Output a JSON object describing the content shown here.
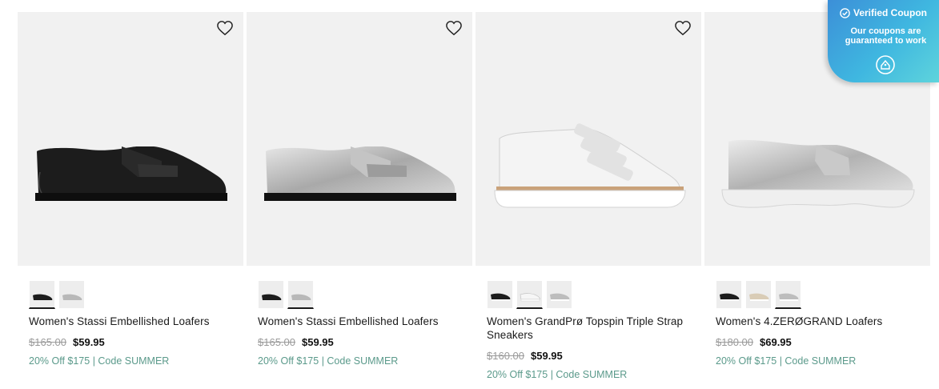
{
  "products": [
    {
      "name": "Women's Stassi Embellished Loafers",
      "was_price": "$165.00",
      "price": "$59.95",
      "promo": "20% Off $175 | Code SUMMER",
      "swatches": [
        "black",
        "silver"
      ]
    },
    {
      "name": "Women's Stassi Embellished Loafers",
      "was_price": "$165.00",
      "price": "$59.95",
      "promo": "20% Off $175 | Code SUMMER",
      "swatches": [
        "black",
        "silver"
      ]
    },
    {
      "name": "Women's GrandPrø Topspin Triple Strap Sneakers",
      "was_price": "$160.00",
      "price": "$59.95",
      "promo": "20% Off $175 | Code SUMMER",
      "swatches": [
        "black",
        "white",
        "silver"
      ]
    },
    {
      "name": "Women's 4.ZERØGRAND Loafers",
      "was_price": "$180.00",
      "price": "$69.95",
      "promo": "20% Off $175 | Code SUMMER",
      "swatches": [
        "black",
        "cream",
        "silver"
      ]
    }
  ],
  "coupon": {
    "title": "Verified Coupon",
    "subtitle": "Our coupons are guaranteed to work"
  },
  "icons": {
    "wishlist": "heart-outline-icon",
    "verified": "check-circle-icon",
    "coupon": "tag-icon"
  },
  "colors": {
    "promo_text": "#5b9a8b",
    "image_bg": "#f1f1f1",
    "coupon_gradient_start": "#3c8fd8",
    "coupon_gradient_end": "#5ed4dc"
  }
}
